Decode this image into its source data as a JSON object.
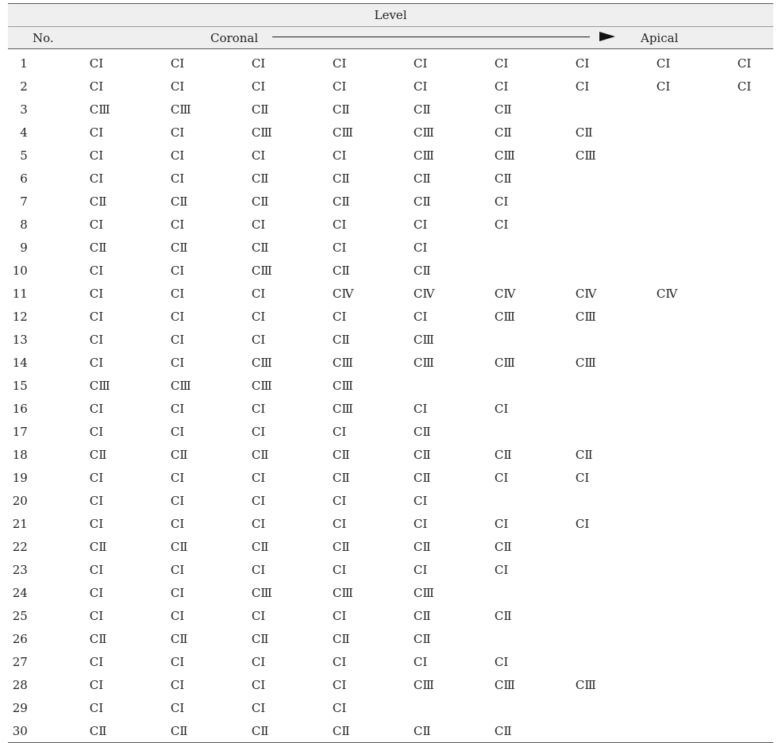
{
  "header": {
    "level_label": "Level",
    "no_label": "No.",
    "coronal_label": "Coronal",
    "apical_label": "Apical"
  },
  "rows": [
    {
      "no": "1",
      "cells": [
        "CⅠ",
        "CⅠ",
        "CⅠ",
        "CⅠ",
        "CⅠ",
        "CⅠ",
        "CⅠ",
        "CⅠ",
        "CⅠ"
      ]
    },
    {
      "no": "2",
      "cells": [
        "CⅠ",
        "CⅠ",
        "CⅠ",
        "CⅠ",
        "CⅠ",
        "CⅠ",
        "CⅠ",
        "CⅠ",
        "CⅠ"
      ]
    },
    {
      "no": "3",
      "cells": [
        "CⅢ",
        "CⅢ",
        "CⅡ",
        "CⅡ",
        "CⅡ",
        "CⅡ",
        "",
        "",
        ""
      ]
    },
    {
      "no": "4",
      "cells": [
        "CⅠ",
        "CⅠ",
        "CⅢ",
        "CⅢ",
        "CⅢ",
        "CⅡ",
        "CⅡ",
        "",
        ""
      ]
    },
    {
      "no": "5",
      "cells": [
        "CⅠ",
        "CⅠ",
        "CⅠ",
        "CⅠ",
        "CⅢ",
        "CⅢ",
        "CⅢ",
        "",
        ""
      ]
    },
    {
      "no": "6",
      "cells": [
        "CⅠ",
        "CⅠ",
        "CⅡ",
        "CⅡ",
        "CⅡ",
        "CⅡ",
        "",
        "",
        ""
      ]
    },
    {
      "no": "7",
      "cells": [
        "CⅡ",
        "CⅡ",
        "CⅡ",
        "CⅡ",
        "CⅡ",
        "CⅠ",
        "",
        "",
        ""
      ]
    },
    {
      "no": "8",
      "cells": [
        "CⅠ",
        "CⅠ",
        "CⅠ",
        "CⅠ",
        "CⅠ",
        "CⅠ",
        "",
        "",
        ""
      ]
    },
    {
      "no": "9",
      "cells": [
        "CⅡ",
        "CⅡ",
        "CⅡ",
        "CⅠ",
        "CⅠ",
        "",
        "",
        "",
        ""
      ]
    },
    {
      "no": "10",
      "cells": [
        "CⅠ",
        "CⅠ",
        "CⅢ",
        "CⅡ",
        "CⅡ",
        "",
        "",
        "",
        ""
      ]
    },
    {
      "no": "11",
      "cells": [
        "CⅠ",
        "CⅠ",
        "CⅠ",
        "CⅣ",
        "CⅣ",
        "CⅣ",
        "CⅣ",
        "CⅣ",
        ""
      ]
    },
    {
      "no": "12",
      "cells": [
        "CⅠ",
        "CⅠ",
        "CⅠ",
        "CⅠ",
        "CⅠ",
        "CⅢ",
        "CⅢ",
        "",
        ""
      ]
    },
    {
      "no": "13",
      "cells": [
        "CⅠ",
        "CⅠ",
        "CⅠ",
        "CⅡ",
        "CⅢ",
        "",
        "",
        "",
        ""
      ]
    },
    {
      "no": "14",
      "cells": [
        "CⅠ",
        "CⅠ",
        "CⅢ",
        "CⅢ",
        "CⅢ",
        "CⅢ",
        "CⅢ",
        "",
        ""
      ]
    },
    {
      "no": "15",
      "cells": [
        "CⅢ",
        "CⅢ",
        "CⅢ",
        "CⅢ",
        "",
        "",
        "",
        "",
        ""
      ]
    },
    {
      "no": "16",
      "cells": [
        "CⅠ",
        "CⅠ",
        "CⅠ",
        "CⅢ",
        "CⅠ",
        "CⅠ",
        "",
        "",
        ""
      ]
    },
    {
      "no": "17",
      "cells": [
        "CⅠ",
        "CⅠ",
        "CⅠ",
        "CⅠ",
        "CⅡ",
        "",
        "",
        "",
        ""
      ]
    },
    {
      "no": "18",
      "cells": [
        "CⅡ",
        "CⅡ",
        "CⅡ",
        "CⅡ",
        "CⅡ",
        "CⅡ",
        "CⅡ",
        "",
        ""
      ]
    },
    {
      "no": "19",
      "cells": [
        "CⅠ",
        "CⅠ",
        "CⅠ",
        "CⅡ",
        "CⅡ",
        "CⅠ",
        "CⅠ",
        "",
        ""
      ]
    },
    {
      "no": "20",
      "cells": [
        "CⅠ",
        "CⅠ",
        "CⅠ",
        "CⅠ",
        "CⅠ",
        "",
        "",
        "",
        ""
      ]
    },
    {
      "no": "21",
      "cells": [
        "CⅠ",
        "CⅠ",
        "CⅠ",
        "CⅠ",
        "CⅠ",
        "CⅠ",
        "CⅠ",
        "",
        ""
      ]
    },
    {
      "no": "22",
      "cells": [
        "CⅡ",
        "CⅡ",
        "CⅡ",
        "CⅡ",
        "CⅡ",
        "CⅡ",
        "",
        "",
        ""
      ]
    },
    {
      "no": "23",
      "cells": [
        "CⅠ",
        "CⅠ",
        "CⅠ",
        "CⅠ",
        "CⅠ",
        "CⅠ",
        "",
        "",
        ""
      ]
    },
    {
      "no": "24",
      "cells": [
        "CⅠ",
        "CⅠ",
        "CⅢ",
        "CⅢ",
        "CⅢ",
        "",
        "",
        "",
        ""
      ]
    },
    {
      "no": "25",
      "cells": [
        "CⅠ",
        "CⅠ",
        "CⅠ",
        "CⅠ",
        "CⅡ",
        "CⅡ",
        "",
        "",
        ""
      ]
    },
    {
      "no": "26",
      "cells": [
        "CⅡ",
        "CⅡ",
        "CⅡ",
        "CⅡ",
        "CⅡ",
        "",
        "",
        "",
        ""
      ]
    },
    {
      "no": "27",
      "cells": [
        "CⅠ",
        "CⅠ",
        "CⅠ",
        "CⅠ",
        "CⅠ",
        "CⅠ",
        "",
        "",
        ""
      ]
    },
    {
      "no": "28",
      "cells": [
        "CⅠ",
        "CⅠ",
        "CⅠ",
        "CⅠ",
        "CⅢ",
        "CⅢ",
        "CⅢ",
        "",
        ""
      ]
    },
    {
      "no": "29",
      "cells": [
        "CⅠ",
        "CⅠ",
        "CⅠ",
        "CⅠ",
        "",
        "",
        "",
        "",
        ""
      ]
    },
    {
      "no": "30",
      "cells": [
        "CⅡ",
        "CⅡ",
        "CⅡ",
        "CⅡ",
        "CⅡ",
        "CⅡ",
        "",
        "",
        ""
      ]
    }
  ]
}
